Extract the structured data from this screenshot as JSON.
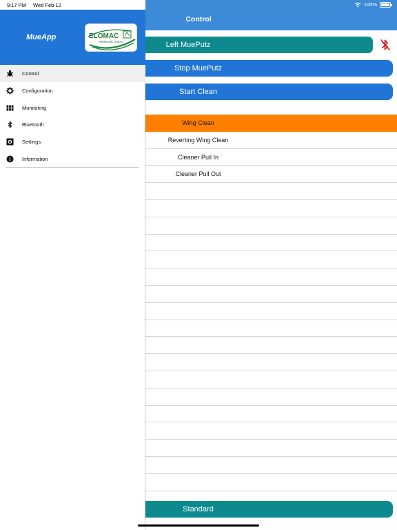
{
  "status_bar": {
    "time": "9:17 PM",
    "date": "Wed Feb 12",
    "wifi_icon": "wifi-icon",
    "battery_text": "100%",
    "battery_level": 1.0
  },
  "drawer": {
    "app_name": "MueApp",
    "logo": {
      "brand": "ELOMAC",
      "subtitle": "Elektronik GmbH"
    },
    "items": [
      {
        "label": "Control",
        "icon": "bug-icon",
        "active": true
      },
      {
        "label": "Configuration",
        "icon": "gear-icon",
        "active": false
      },
      {
        "label": "Monitoring",
        "icon": "grid-icon",
        "active": false
      },
      {
        "label": "Bluetooth",
        "icon": "bluetooth-icon",
        "active": false
      },
      {
        "label": "Settings",
        "icon": "settings-icon",
        "active": false
      },
      {
        "label": "Information",
        "icon": "info-icon",
        "active": false
      }
    ]
  },
  "main": {
    "title": "Control",
    "buttons": {
      "left_label": "Left MuePutz",
      "stop_label": "Stop MuePutz",
      "start_label": "Start Clean",
      "standard_label": "Standard"
    },
    "bluetooth_status_icon": "bluetooth-disabled-icon",
    "list": [
      {
        "label": "Wing Clean",
        "active": true
      },
      {
        "label": "Reverting Wing Clean",
        "active": false
      },
      {
        "label": "Cleaner Pull In",
        "active": false
      },
      {
        "label": "Cleaner Pull Out",
        "active": false
      },
      {
        "label": ""
      },
      {
        "label": ""
      },
      {
        "label": ""
      },
      {
        "label": ""
      },
      {
        "label": ""
      },
      {
        "label": ""
      },
      {
        "label": ""
      },
      {
        "label": ""
      },
      {
        "label": ""
      },
      {
        "label": ""
      },
      {
        "label": ""
      },
      {
        "label": ""
      },
      {
        "label": ""
      },
      {
        "label": ""
      },
      {
        "label": ""
      },
      {
        "label": ""
      },
      {
        "label": ""
      },
      {
        "label": ""
      }
    ]
  },
  "colors": {
    "header_blue": "#3d8ad9",
    "button_blue": "#2075d6",
    "button_teal": "#0d8a8e",
    "active_orange": "#ff8000",
    "bluetooth_red": "#cc1f1f"
  }
}
